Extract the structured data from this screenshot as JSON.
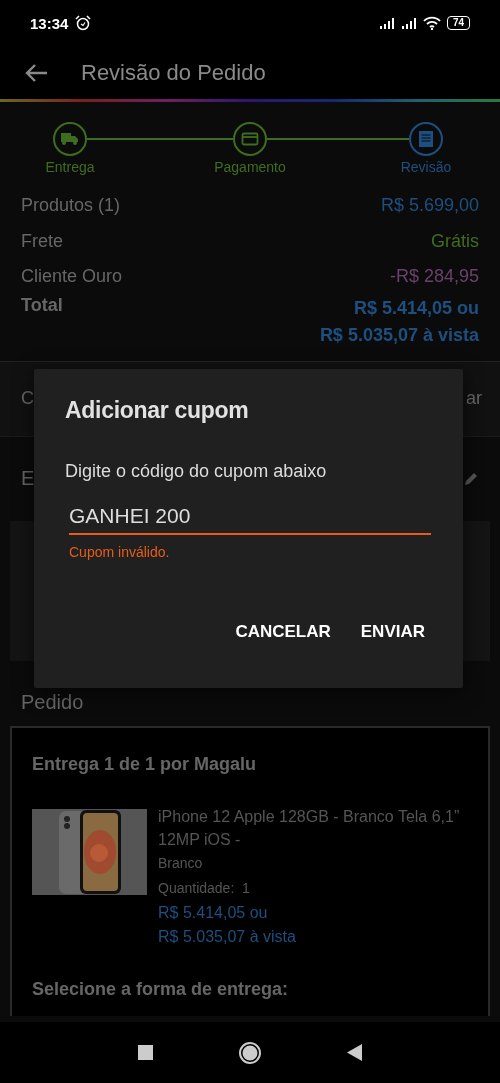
{
  "status_bar": {
    "time": "13:34",
    "battery": "74"
  },
  "app_bar": {
    "title": "Revisão do Pedido"
  },
  "steps": [
    {
      "label": "Entrega",
      "selected": false
    },
    {
      "label": "Pagamento",
      "selected": false
    },
    {
      "label": "Revisão",
      "selected": true
    }
  ],
  "summary": [
    {
      "label": "Produtos (1)",
      "value": "R$ 5.699,00",
      "color": "#1d4f80"
    },
    {
      "label": "Frete",
      "value": "Grátis",
      "color": "#3f6d1f"
    },
    {
      "label": "Cliente Ouro",
      "value": "-R$ 284,95",
      "color": "#6a416c"
    }
  ],
  "total": {
    "label": "Total",
    "lines": [
      "R$ 5.414,05 ou",
      "R$ 5.035,07 à vista"
    ]
  },
  "coupon_row": {
    "left": "C",
    "right": "ar"
  },
  "address": {
    "heading": "E"
  },
  "order": {
    "heading": "Pedido",
    "delivery_title": "Entrega 1 de 1 por Magalu",
    "product": {
      "name": "iPhone 12 Apple 128GB - Branco Tela 6,1” 12MP iOS -",
      "variant": "Branco",
      "quantity_label": "Quantidade:",
      "quantity": "1",
      "price_lines": [
        "R$ 5.414,05 ou",
        "R$ 5.035,07 à vista"
      ]
    },
    "shipping_prompt": "Selecione a forma de entrega:"
  },
  "dialog": {
    "title": "Adicionar cupom",
    "message": "Digite o código do cupom abaixo",
    "value": "GANHEI 200",
    "error": "Cupom inválido.",
    "buttons": [
      "CANCELAR",
      "ENVIAR"
    ]
  }
}
